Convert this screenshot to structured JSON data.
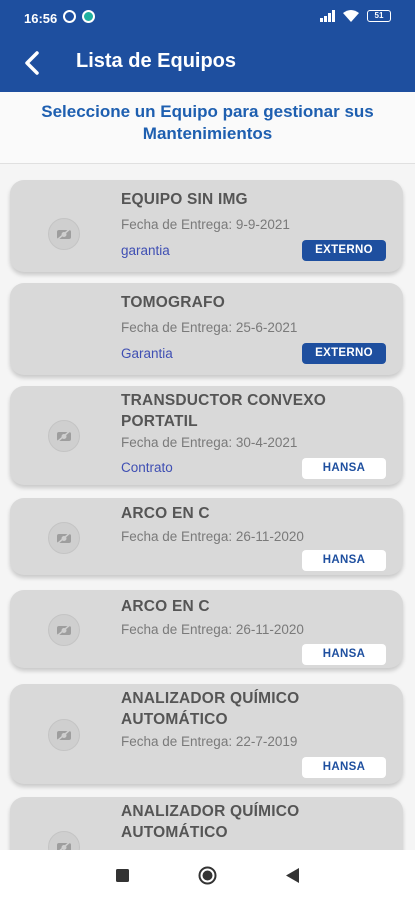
{
  "status_bar": {
    "time": "16:56",
    "battery": "51"
  },
  "app_bar": {
    "title": "Lista de Equipos"
  },
  "subheader": {
    "line1": "Seleccione un Equipo para gestionar sus",
    "line2": "Mantenimientos"
  },
  "colors": {
    "primary": "#1e4f9f",
    "subheader_text": "#1e5fb0",
    "card_bg": "#d9d9d9",
    "condition_text": "#3f4fb3"
  },
  "equipos": [
    {
      "name_lines": [
        "EQUIPO SIN IMG"
      ],
      "date": "Fecha de Entrega: 9-9-2021",
      "condition": "garantia",
      "badge": "EXTERNO",
      "badge_style": "dark",
      "has_icon": true
    },
    {
      "name_lines": [
        "TOMOGRAFO"
      ],
      "date": "Fecha de Entrega: 25-6-2021",
      "condition": "Garantia",
      "badge": "EXTERNO",
      "badge_style": "dark",
      "has_icon": false
    },
    {
      "name_lines": [
        "TRANSDUCTOR CONVEXO",
        "PORTATIL"
      ],
      "date": "Fecha de Entrega: 30-4-2021",
      "condition": "Contrato",
      "badge": "HANSA",
      "badge_style": "light",
      "has_icon": true
    },
    {
      "name_lines": [
        "ARCO EN C"
      ],
      "date": "Fecha de Entrega: 26-11-2020",
      "condition": "",
      "badge": "HANSA",
      "badge_style": "light",
      "has_icon": true
    },
    {
      "name_lines": [
        "ARCO EN C"
      ],
      "date": "Fecha de Entrega: 26-11-2020",
      "condition": "",
      "badge": "HANSA",
      "badge_style": "light",
      "has_icon": true
    },
    {
      "name_lines": [
        "ANALIZADOR QUÍMICO",
        "AUTOMÁTICO"
      ],
      "date": "Fecha de Entrega: 22-7-2019",
      "condition": "",
      "badge": "HANSA",
      "badge_style": "light",
      "has_icon": true
    },
    {
      "name_lines": [
        "ANALIZADOR QUÍMICO",
        "AUTOMÁTICO"
      ],
      "date": "",
      "condition": "",
      "badge": "",
      "badge_style": "light",
      "has_icon": true
    }
  ],
  "icons": {
    "back": "arrow-back-icon",
    "thumb": "no-image-camera-icon",
    "nav_recents": "square-icon",
    "nav_home": "circle-icon",
    "nav_back": "triangle-icon"
  }
}
